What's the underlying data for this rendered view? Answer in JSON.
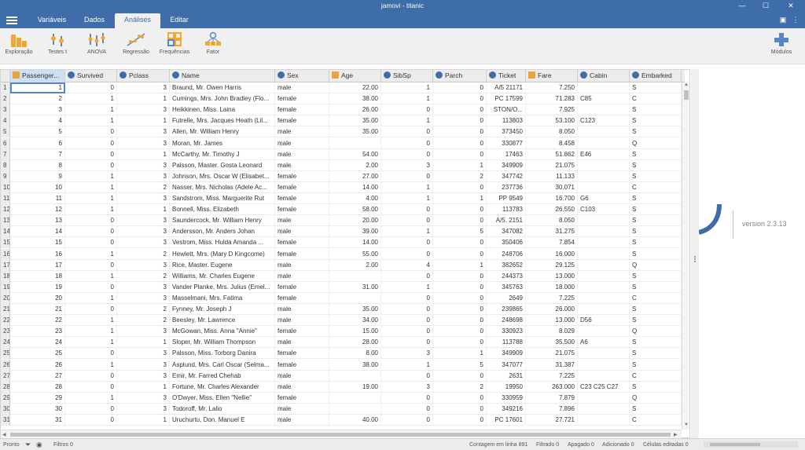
{
  "window": {
    "title": "jamovi - titanic",
    "controls": {
      "minimize": "—",
      "maximize": "☐",
      "close": "✕"
    }
  },
  "menu": {
    "tabs": [
      {
        "label": "Variáveis",
        "active": false
      },
      {
        "label": "Dados",
        "active": false
      },
      {
        "label": "Análises",
        "active": true
      },
      {
        "label": "Editar",
        "active": false
      }
    ]
  },
  "ribbon": {
    "buttons": [
      {
        "label": "Exploração",
        "icon": "bar-chart-icon"
      },
      {
        "label": "Testes t",
        "icon": "t-test-icon"
      },
      {
        "label": "ANOVA",
        "icon": "anova-icon"
      },
      {
        "label": "Regressão",
        "icon": "regression-icon"
      },
      {
        "label": "Frequências",
        "icon": "frequencies-icon"
      },
      {
        "label": "Fator",
        "icon": "factor-icon"
      }
    ],
    "modules_label": "Módulos"
  },
  "grid": {
    "columns": [
      {
        "label": "Passenger...",
        "type": "id",
        "color": "#e8a33a"
      },
      {
        "label": "Survived",
        "type": "nominal",
        "color": "#3e6da9"
      },
      {
        "label": "Pclass",
        "type": "nominal",
        "color": "#3e6da9"
      },
      {
        "label": "Name",
        "type": "nominal-text",
        "color": "#3e6da9"
      },
      {
        "label": "Sex",
        "type": "nominal",
        "color": "#3e6da9"
      },
      {
        "label": "Age",
        "type": "continuous",
        "color": "#e8a33a"
      },
      {
        "label": "SibSp",
        "type": "nominal",
        "color": "#3e6da9"
      },
      {
        "label": "Parch",
        "type": "nominal",
        "color": "#3e6da9"
      },
      {
        "label": "Ticket",
        "type": "nominal-text",
        "color": "#3e6da9"
      },
      {
        "label": "Fare",
        "type": "continuous",
        "color": "#e8a33a"
      },
      {
        "label": "Cabin",
        "type": "nominal-text",
        "color": "#3e6da9"
      },
      {
        "label": "Embarked",
        "type": "nominal",
        "color": "#3e6da9"
      }
    ],
    "rows": [
      [
        "1",
        "1",
        "0",
        "3",
        "Braund, Mr. Owen Harris",
        "male",
        "22.00",
        "1",
        "0",
        "A/5 21171",
        "7.250",
        "",
        "S"
      ],
      [
        "2",
        "2",
        "1",
        "1",
        "Cumings, Mrs. John Bradley (Flo...",
        "female",
        "38.00",
        "1",
        "0",
        "PC 17599",
        "71.283",
        "C85",
        "C"
      ],
      [
        "3",
        "3",
        "1",
        "3",
        "Heikkinen, Miss. Laina",
        "female",
        "26.00",
        "0",
        "0",
        "STON/O...",
        "7.925",
        "",
        "S"
      ],
      [
        "4",
        "4",
        "1",
        "1",
        "Futrelle, Mrs. Jacques Heath (Lil...",
        "female",
        "35.00",
        "1",
        "0",
        "113803",
        "53.100",
        "C123",
        "S"
      ],
      [
        "5",
        "5",
        "0",
        "3",
        "Allen, Mr. William Henry",
        "male",
        "35.00",
        "0",
        "0",
        "373450",
        "8.050",
        "",
        "S"
      ],
      [
        "6",
        "6",
        "0",
        "3",
        "Moran, Mr. James",
        "male",
        "",
        "0",
        "0",
        "330877",
        "8.458",
        "",
        "Q"
      ],
      [
        "7",
        "7",
        "0",
        "1",
        "McCarthy, Mr. Timothy J",
        "male",
        "54.00",
        "0",
        "0",
        "17463",
        "51.862",
        "E46",
        "S"
      ],
      [
        "8",
        "8",
        "0",
        "3",
        "Palsson, Master. Gosta Leonard",
        "male",
        "2.00",
        "3",
        "1",
        "349909",
        "21.075",
        "",
        "S"
      ],
      [
        "9",
        "9",
        "1",
        "3",
        "Johnson, Mrs. Oscar W (Elisabet...",
        "female",
        "27.00",
        "0",
        "2",
        "347742",
        "11.133",
        "",
        "S"
      ],
      [
        "10",
        "10",
        "1",
        "2",
        "Nasser, Mrs. Nicholas (Adele Ac...",
        "female",
        "14.00",
        "1",
        "0",
        "237736",
        "30.071",
        "",
        "C"
      ],
      [
        "11",
        "11",
        "1",
        "3",
        "Sandstrom, Miss. Marguerite Rut",
        "female",
        "4.00",
        "1",
        "1",
        "PP 9549",
        "16.700",
        "G6",
        "S"
      ],
      [
        "12",
        "12",
        "1",
        "1",
        "Bonnell, Miss. Elizabeth",
        "female",
        "58.00",
        "0",
        "0",
        "113783",
        "26.550",
        "C103",
        "S"
      ],
      [
        "13",
        "13",
        "0",
        "3",
        "Saundercock, Mr. William Henry",
        "male",
        "20.00",
        "0",
        "0",
        "A/5. 2151",
        "8.050",
        "",
        "S"
      ],
      [
        "14",
        "14",
        "0",
        "3",
        "Andersson, Mr. Anders Johan",
        "male",
        "39.00",
        "1",
        "5",
        "347082",
        "31.275",
        "",
        "S"
      ],
      [
        "15",
        "15",
        "0",
        "3",
        "Vestrom, Miss. Hulda Amanda ...",
        "female",
        "14.00",
        "0",
        "0",
        "350406",
        "7.854",
        "",
        "S"
      ],
      [
        "16",
        "16",
        "1",
        "2",
        "Hewlett, Mrs. (Mary D Kingcome)",
        "female",
        "55.00",
        "0",
        "0",
        "248706",
        "16.000",
        "",
        "S"
      ],
      [
        "17",
        "17",
        "0",
        "3",
        "Rice, Master. Eugene",
        "male",
        "2.00",
        "4",
        "1",
        "382652",
        "29.125",
        "",
        "Q"
      ],
      [
        "18",
        "18",
        "1",
        "2",
        "Williams, Mr. Charles Eugene",
        "male",
        "",
        "0",
        "0",
        "244373",
        "13.000",
        "",
        "S"
      ],
      [
        "19",
        "19",
        "0",
        "3",
        "Vander Planke, Mrs. Julius (Emel...",
        "female",
        "31.00",
        "1",
        "0",
        "345763",
        "18.000",
        "",
        "S"
      ],
      [
        "20",
        "20",
        "1",
        "3",
        "Masselmani, Mrs. Fatima",
        "female",
        "",
        "0",
        "0",
        "2649",
        "7.225",
        "",
        "C"
      ],
      [
        "21",
        "21",
        "0",
        "2",
        "Fynney, Mr. Joseph J",
        "male",
        "35.00",
        "0",
        "0",
        "239865",
        "26.000",
        "",
        "S"
      ],
      [
        "22",
        "22",
        "1",
        "2",
        "Beesley, Mr. Lawrence",
        "male",
        "34.00",
        "0",
        "0",
        "248698",
        "13.000",
        "D56",
        "S"
      ],
      [
        "23",
        "23",
        "1",
        "3",
        "McGowan, Miss. Anna \"Annie\"",
        "female",
        "15.00",
        "0",
        "0",
        "330923",
        "8.029",
        "",
        "Q"
      ],
      [
        "24",
        "24",
        "1",
        "1",
        "Sloper, Mr. William Thompson",
        "male",
        "28.00",
        "0",
        "0",
        "113788",
        "35.500",
        "A6",
        "S"
      ],
      [
        "25",
        "25",
        "0",
        "3",
        "Palsson, Miss. Torborg Danira",
        "female",
        "8.00",
        "3",
        "1",
        "349909",
        "21.075",
        "",
        "S"
      ],
      [
        "26",
        "26",
        "1",
        "3",
        "Asplund, Mrs. Carl Oscar (Selma...",
        "female",
        "38.00",
        "1",
        "5",
        "347077",
        "31.387",
        "",
        "S"
      ],
      [
        "27",
        "27",
        "0",
        "3",
        "Emir, Mr. Farred Chehab",
        "male",
        "",
        "0",
        "0",
        "2631",
        "7.225",
        "",
        "C"
      ],
      [
        "28",
        "28",
        "0",
        "1",
        "Fortune, Mr. Charles Alexander",
        "male",
        "19.00",
        "3",
        "2",
        "19950",
        "263.000",
        "C23 C25 C27",
        "S"
      ],
      [
        "29",
        "29",
        "1",
        "3",
        "O'Dwyer, Miss. Ellen \"Nellie\"",
        "female",
        "",
        "0",
        "0",
        "330959",
        "7.879",
        "",
        "Q"
      ],
      [
        "30",
        "30",
        "0",
        "3",
        "Todoroff, Mr. Lalio",
        "male",
        "",
        "0",
        "0",
        "349216",
        "7.896",
        "",
        "S"
      ],
      [
        "31",
        "31",
        "0",
        "1",
        "Uruchurtu, Don. Manuel E",
        "male",
        "40.00",
        "0",
        "0",
        "PC 17601",
        "27.721",
        "",
        "C"
      ]
    ]
  },
  "results": {
    "version": "version 2.3.13"
  },
  "status": {
    "ready": "Pronto",
    "filters": "Filtros 0",
    "row_count": "Contagem em linha 891",
    "filtered": "Filtrado 0",
    "deleted": "Apagado 0",
    "added": "Adicionado 0",
    "edited": "Células editadas 0"
  }
}
